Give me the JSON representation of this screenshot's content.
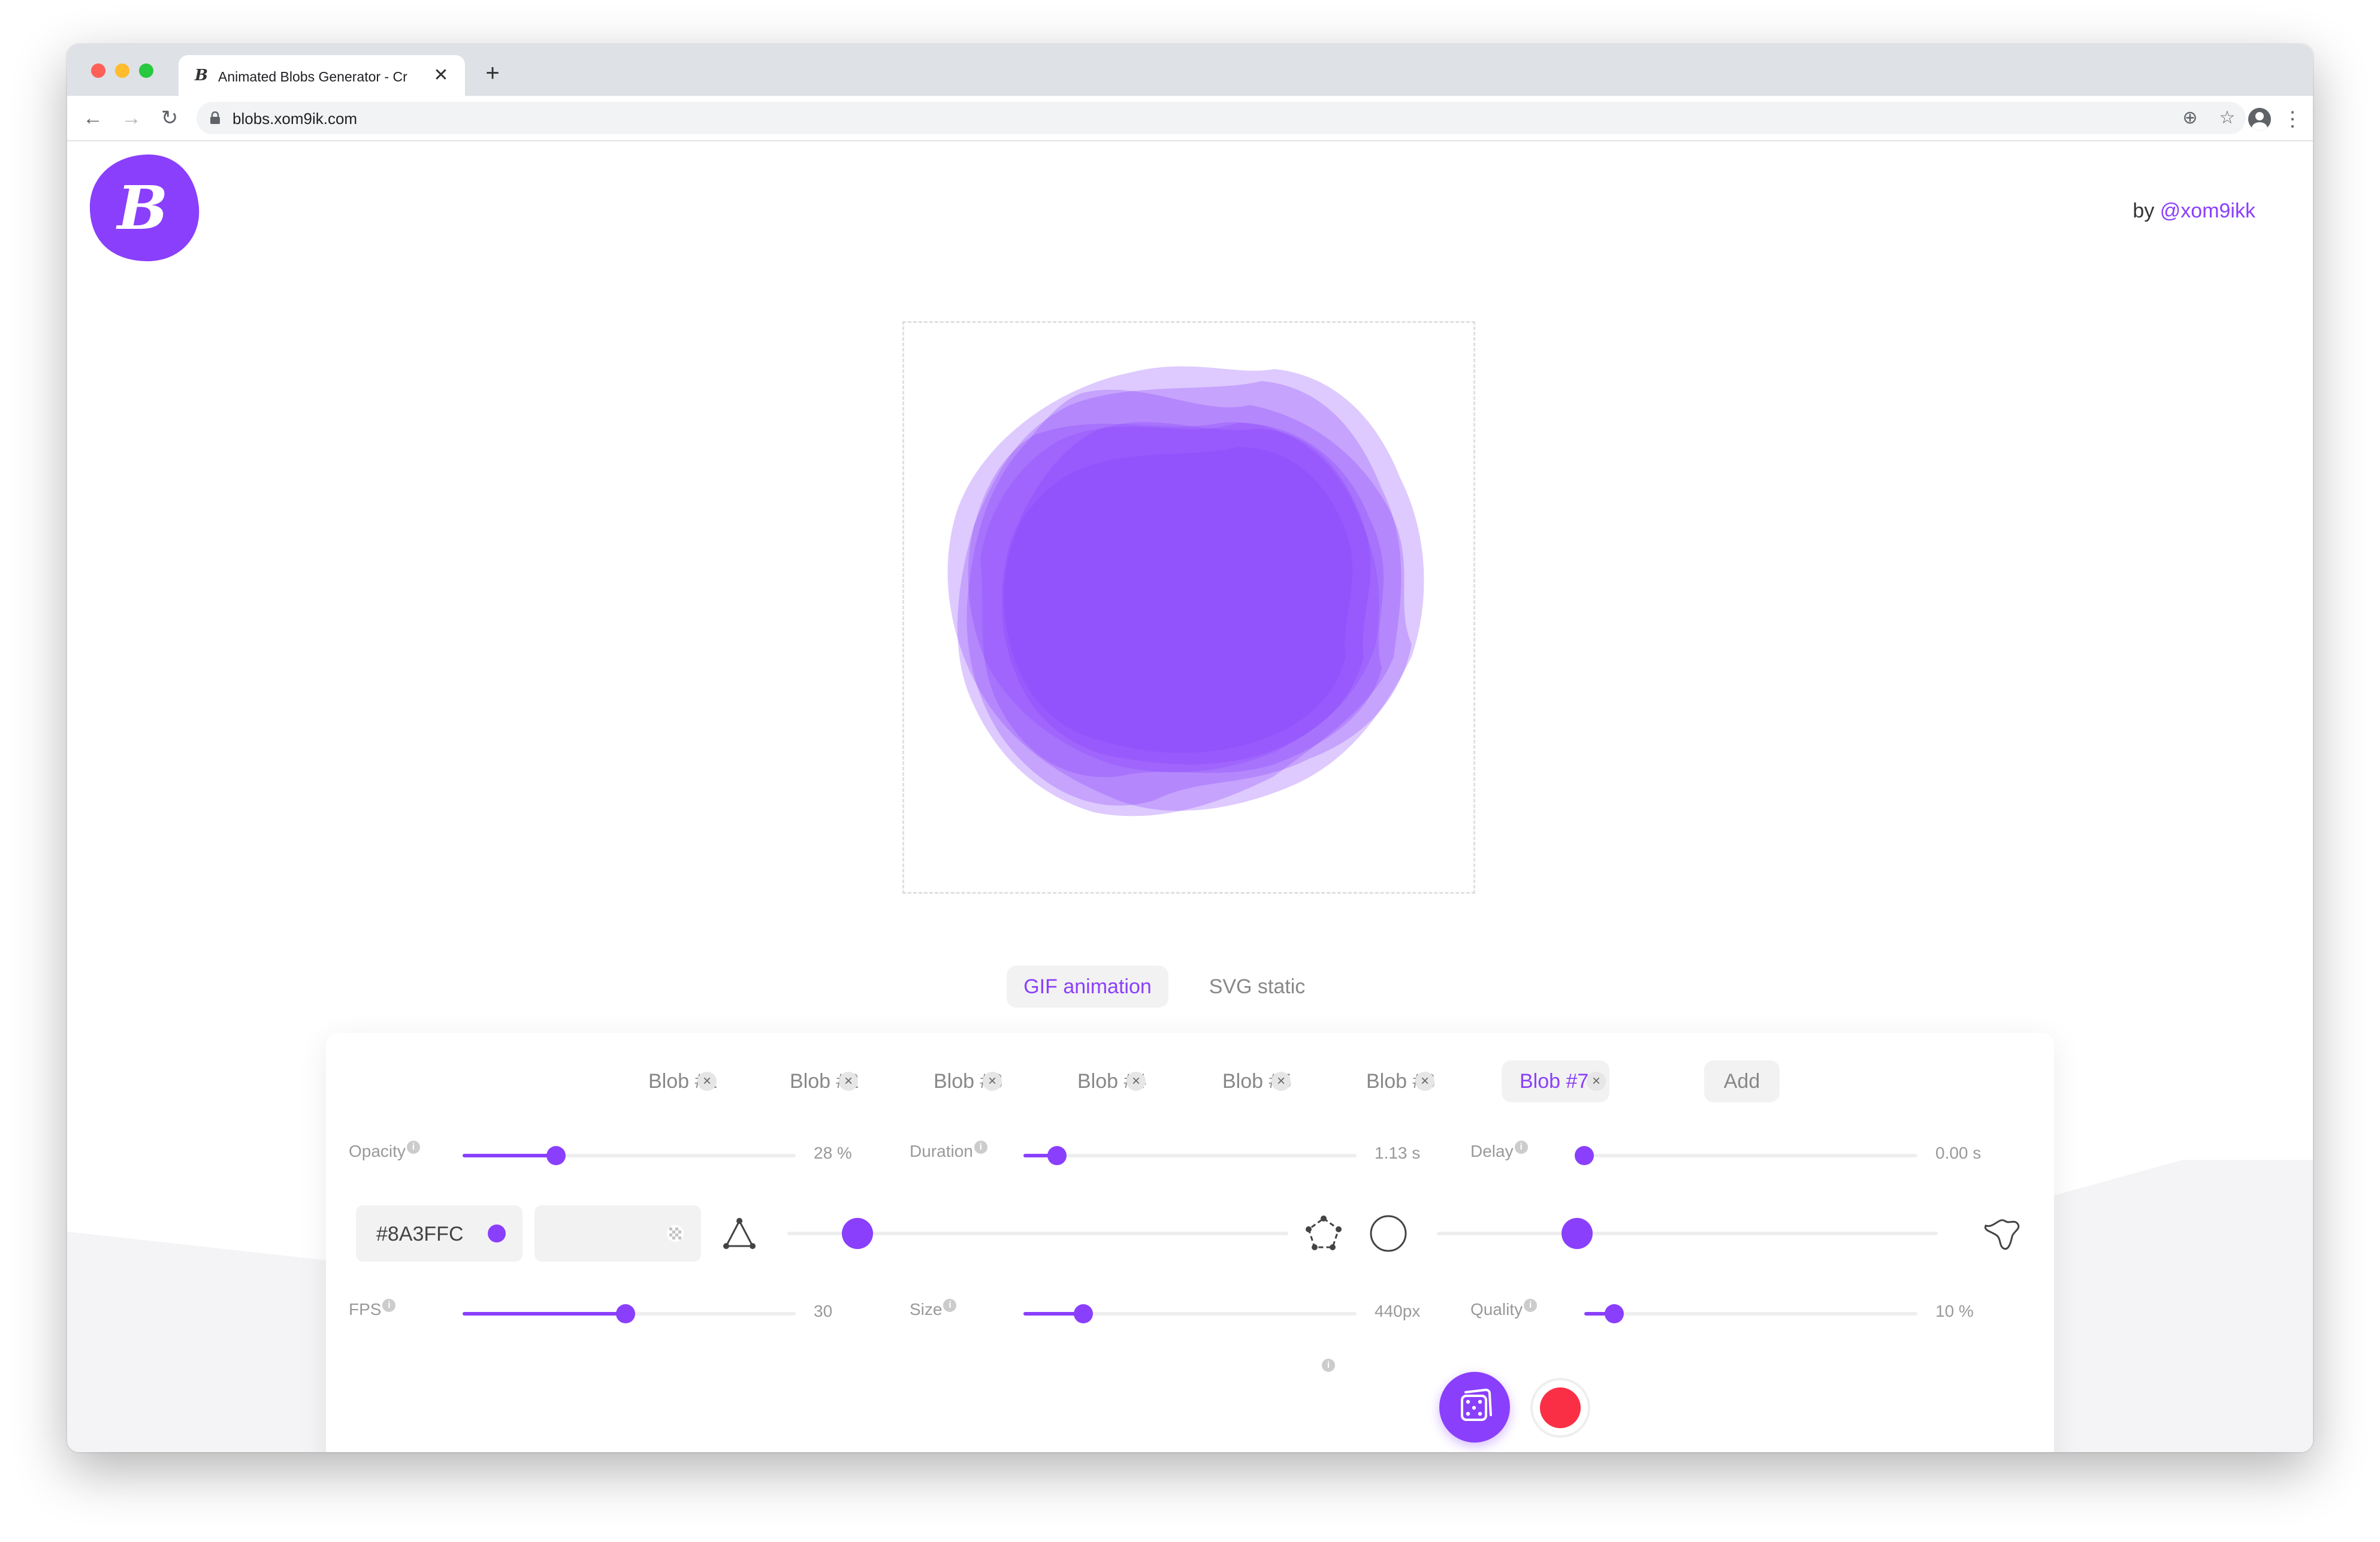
{
  "browser": {
    "tab_title": "Animated Blobs Generator - Cr",
    "tab_favicon": "B",
    "tab_close": "✕",
    "new_tab": "+",
    "url": "blobs.xom9ik.com",
    "nav": {
      "back": "←",
      "forward": "→",
      "reload": "↻"
    },
    "icons": [
      "back-icon",
      "forward-icon",
      "reload-icon",
      "lock-icon",
      "add-to-page-icon",
      "bookmark-star-icon",
      "profile-icon",
      "menu-kebab-icon"
    ],
    "omni_add": "⊕",
    "omni_star": "☆",
    "menu": "⋮"
  },
  "header": {
    "logo_letter": "B",
    "author_prefix": "by ",
    "author_handle": "@xom9ikk"
  },
  "colors": {
    "accent": "#8a3ffc",
    "record": "#fa2f45",
    "panel_bg": "#ffffff",
    "muted_text": "#999999"
  },
  "mode_tabs": [
    {
      "label": "GIF animation",
      "active": true
    },
    {
      "label": "SVG static",
      "active": false
    }
  ],
  "blob_tabs": [
    {
      "label": "Blob #1",
      "active": false
    },
    {
      "label": "Blob #2",
      "active": false
    },
    {
      "label": "Blob #3",
      "active": false
    },
    {
      "label": "Blob #4",
      "active": false
    },
    {
      "label": "Blob #5",
      "active": false
    },
    {
      "label": "Blob #6",
      "active": false
    },
    {
      "label": "Blob #7",
      "active": true
    }
  ],
  "close_glyph": "×",
  "add_label": "Add",
  "info_glyph": "i",
  "sliders": {
    "opacity": {
      "label": "Opacity",
      "value": "28 %",
      "level": 0.28
    },
    "duration": {
      "label": "Duration",
      "value": "1.13 s",
      "level": 0.1
    },
    "delay": {
      "label": "Delay",
      "value": "0.00 s",
      "level": 0.0
    },
    "complexity": {
      "level": 0.14
    },
    "randomness": {
      "level": 0.28
    },
    "fps": {
      "label": "FPS",
      "value": "30",
      "level": 0.49
    },
    "size": {
      "label": "Size",
      "value": "440px",
      "level": 0.18
    },
    "quality": {
      "label": "Quality",
      "value": "10 %",
      "level": 0.09
    }
  },
  "color_value": "#8A3FFC",
  "shape_icons": [
    "triangle-nodes-icon",
    "pentagon-nodes-icon",
    "circle-shape-icon",
    "irregular-blob-icon"
  ],
  "action_icons": [
    "randomize-dice-icon",
    "record-icon"
  ]
}
